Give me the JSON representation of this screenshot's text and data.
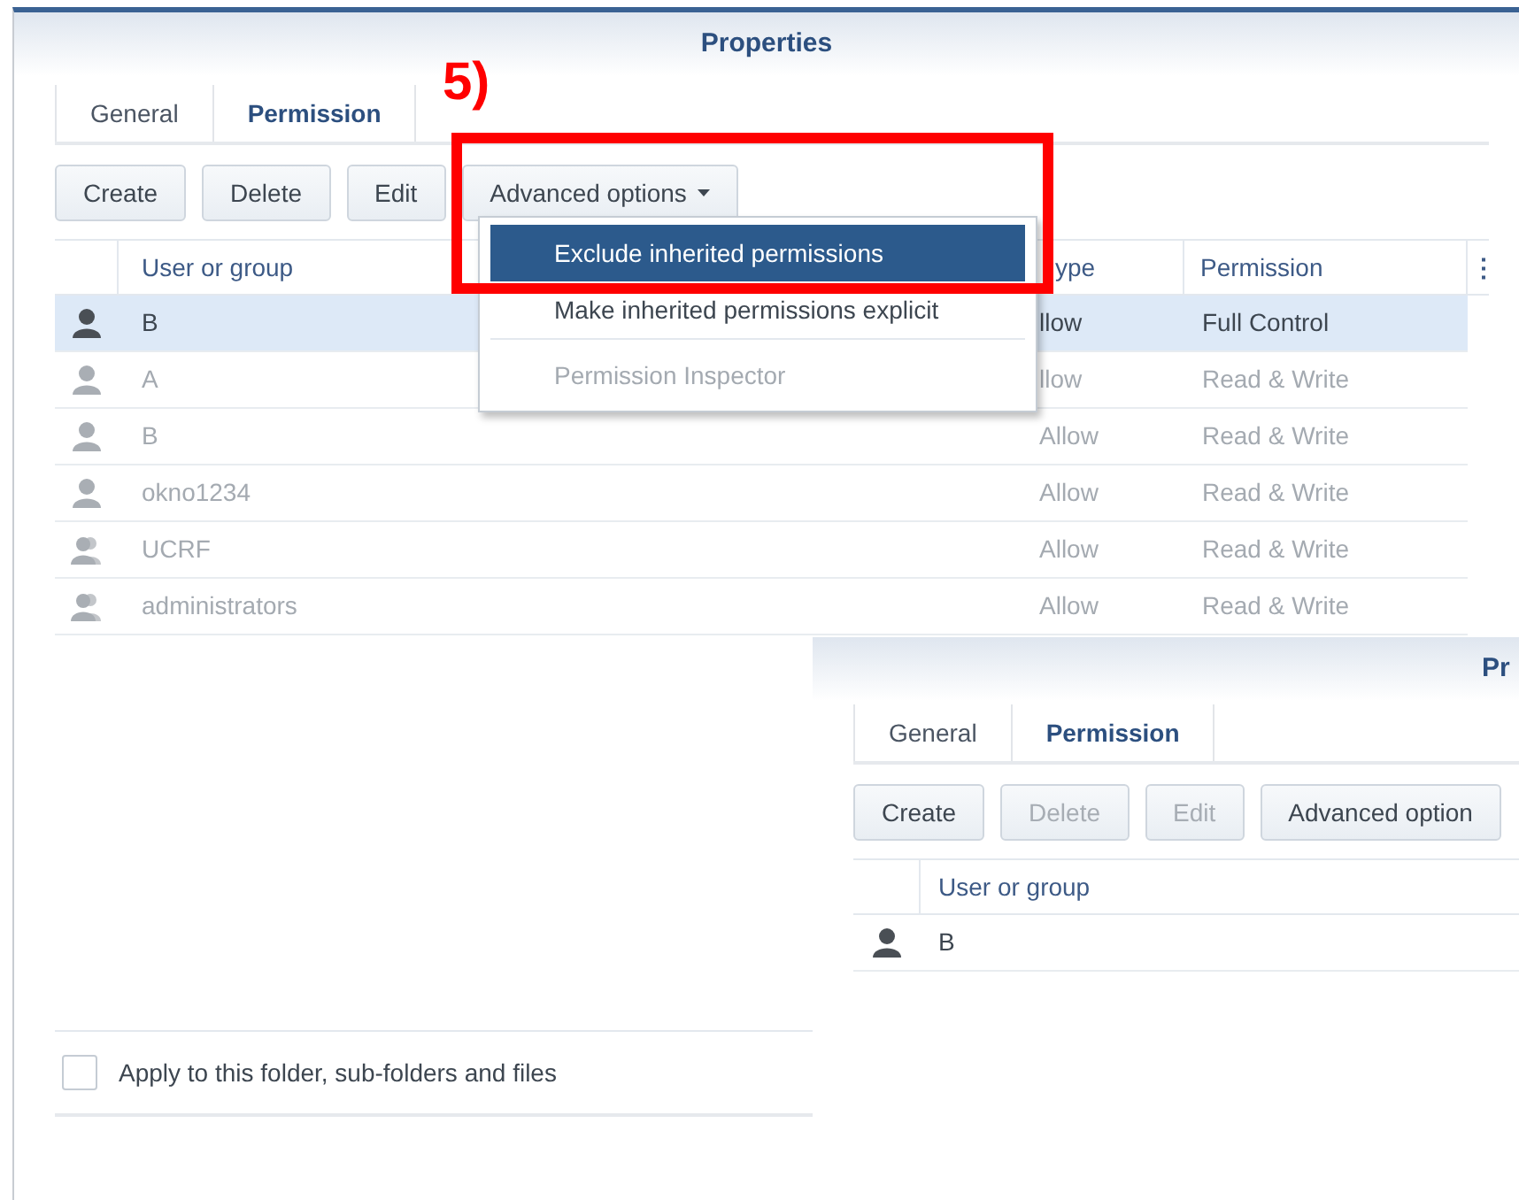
{
  "window": {
    "title": "Properties",
    "tabs": [
      {
        "label": "General",
        "selected": false
      },
      {
        "label": "Permission",
        "selected": true
      }
    ],
    "toolbar": [
      {
        "label": "Create",
        "disabled": false
      },
      {
        "label": "Delete",
        "disabled": false
      },
      {
        "label": "Edit",
        "disabled": false
      },
      {
        "label": "Advanced options",
        "disabled": false,
        "dropdown": true
      }
    ],
    "dropdown_menu": [
      {
        "label": "Exclude inherited permissions",
        "selected": true,
        "disabled": false
      },
      {
        "label": "Make inherited permissions explicit",
        "selected": false,
        "disabled": false
      },
      {
        "label": "Permission Inspector",
        "selected": false,
        "disabled": true
      }
    ],
    "table": {
      "columns": [
        "User or group",
        "ype",
        "Permission",
        "⋮"
      ],
      "rows": [
        {
          "kind": "user",
          "name": "B",
          "type": "llow",
          "permission": "Full Control",
          "selected": true,
          "inherited": false
        },
        {
          "kind": "user",
          "name": "A",
          "type": "llow",
          "permission": "Read & Write",
          "selected": false,
          "inherited": true
        },
        {
          "kind": "user",
          "name": "B",
          "type": "Allow",
          "permission": "Read & Write",
          "selected": false,
          "inherited": true
        },
        {
          "kind": "user",
          "name": "okno1234",
          "type": "Allow",
          "permission": "Read & Write",
          "selected": false,
          "inherited": true
        },
        {
          "kind": "group",
          "name": "UCRF",
          "type": "Allow",
          "permission": "Read & Write",
          "selected": false,
          "inherited": true
        },
        {
          "kind": "group",
          "name": "administrators",
          "type": "Allow",
          "permission": "Read & Write",
          "selected": false,
          "inherited": true
        }
      ]
    },
    "apply_checkbox": {
      "label": "Apply to this folder, sub-folders and files",
      "checked": false
    }
  },
  "annotation": {
    "label": "5)"
  },
  "second_window": {
    "title": "Pr",
    "tabs": [
      {
        "label": "General",
        "selected": false
      },
      {
        "label": "Permission",
        "selected": true
      }
    ],
    "toolbar": [
      {
        "label": "Create",
        "disabled": false
      },
      {
        "label": "Delete",
        "disabled": true
      },
      {
        "label": "Edit",
        "disabled": true
      },
      {
        "label": "Advanced option",
        "disabled": false
      }
    ],
    "table": {
      "columns": [
        "User or group"
      ],
      "rows": [
        {
          "kind": "user",
          "name": "B",
          "selected": false,
          "inherited": false
        }
      ]
    }
  }
}
